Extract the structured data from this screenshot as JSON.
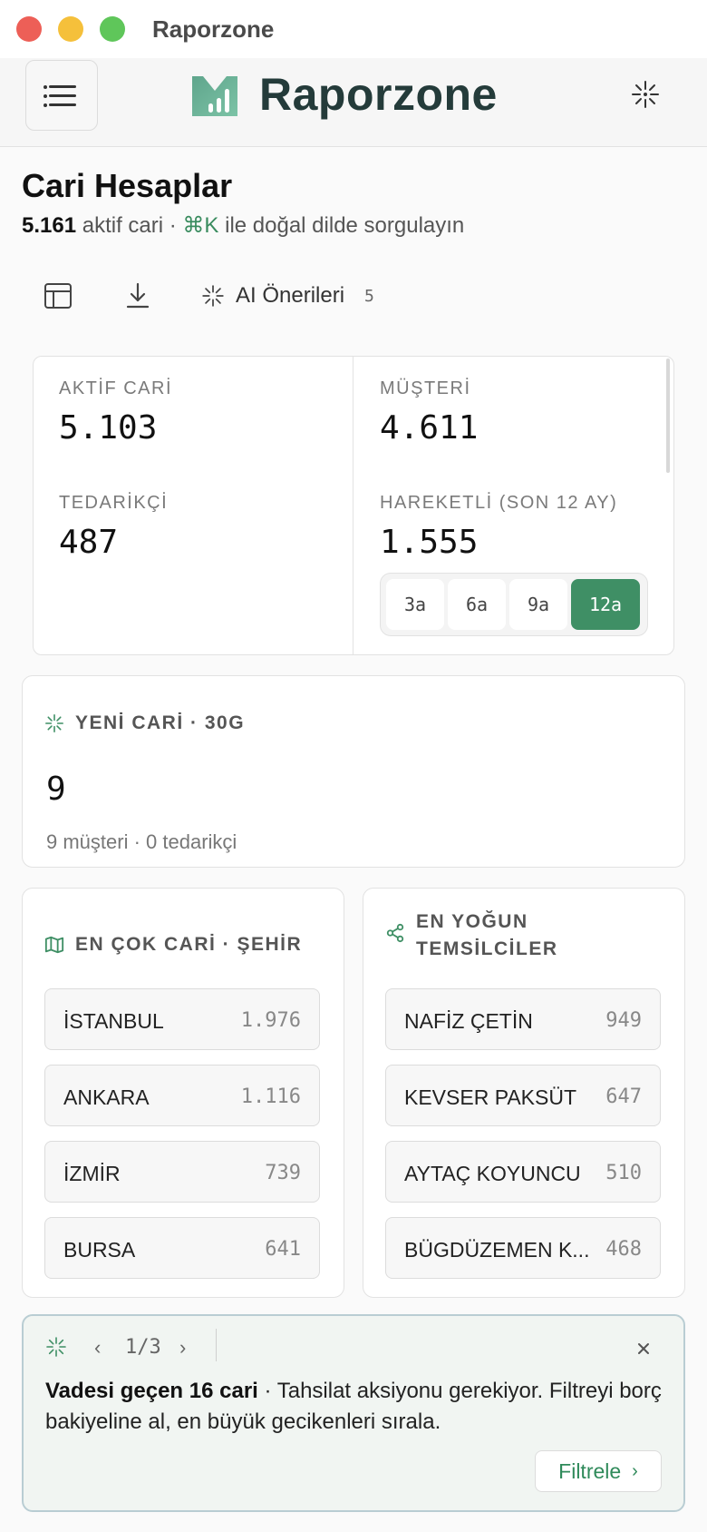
{
  "window": {
    "title": "Raporzone"
  },
  "header": {
    "app_name": "Raporzone"
  },
  "page": {
    "title": "Cari Hesaplar",
    "count": "5.161",
    "subtitle_mid": " aktif cari · ",
    "shortcut": "⌘K",
    "subtitle_end": " ile doğal dilde sorgulayın"
  },
  "toolbar": {
    "ai_label": "AI Önerileri",
    "ai_count": "5"
  },
  "stats": {
    "aktif_label": "AKTİF CARİ",
    "aktif_value": "5.103",
    "musteri_label": "MÜŞTERİ",
    "musteri_value": "4.611",
    "tedarikci_label": "TEDARİKÇİ",
    "tedarikci_value": "487",
    "hareketli_label": "HAREKETLİ (SON 12 AY)",
    "hareketli_value": "1.555",
    "ranges": [
      "3a",
      "6a",
      "9a",
      "12a"
    ],
    "selected_range": "12a"
  },
  "new_cari": {
    "title": "YENİ CARİ · 30G",
    "value": "9",
    "detail": "9 müşteri · 0 tedarikçi"
  },
  "cities": {
    "title": "EN ÇOK CARİ · ŞEHİR",
    "items": [
      {
        "name": "İSTANBUL",
        "count": "1.976"
      },
      {
        "name": "ANKARA",
        "count": "1.116"
      },
      {
        "name": "İZMİR",
        "count": "739"
      },
      {
        "name": "BURSA",
        "count": "641"
      }
    ]
  },
  "reps": {
    "title_line1": "EN YOĞUN",
    "title_line2": "TEMSİLCİLER",
    "items": [
      {
        "name": "NAFİZ ÇETİN",
        "count": "949"
      },
      {
        "name": "KEVSER PAKSÜT",
        "count": "647"
      },
      {
        "name": "AYTAÇ KOYUNCU",
        "count": "510"
      },
      {
        "name": "BÜGDÜZEMEN K...",
        "count": "468"
      }
    ]
  },
  "suggestion": {
    "pager": "1/3",
    "bold": "Vadesi geçen 16 cari",
    "text": " · Tahsilat aksiyonu gerekiyor. Filtreyi borç bakiyeline al, en büyük gecikenleri sırala.",
    "action": "Filtrele"
  },
  "colors": {
    "accent": "#3f8f65",
    "brand": "#243b3a"
  },
  "icons": {
    "menu": "menu-icon",
    "sparkle": "sparkle-icon",
    "table": "table-icon",
    "download": "download-icon",
    "map": "map-icon",
    "share": "share-icon",
    "close": "close-icon"
  }
}
